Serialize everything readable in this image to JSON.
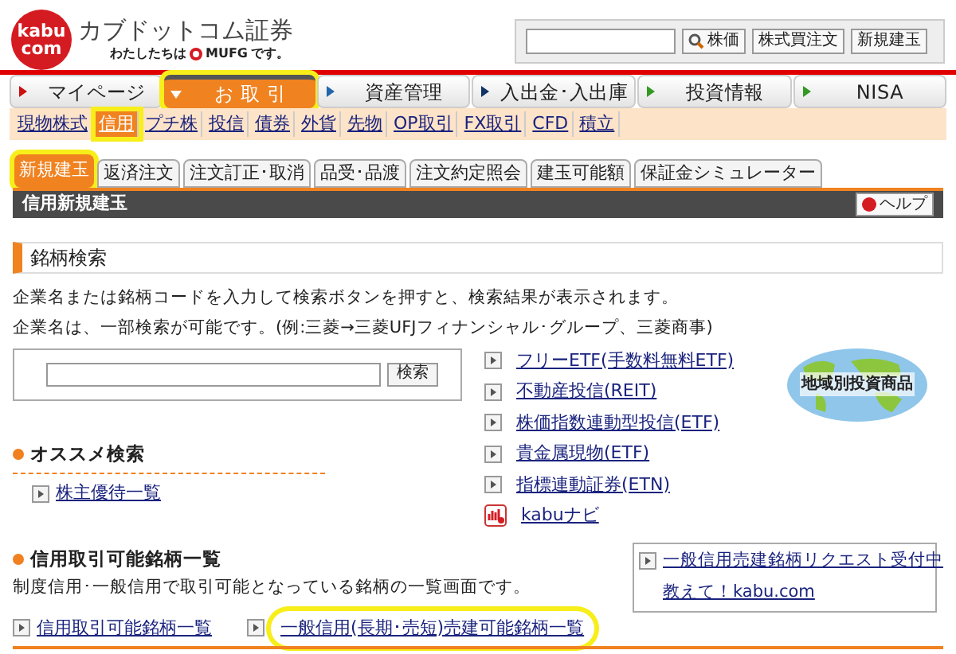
{
  "logo": {
    "mark_top": "kabu",
    "mark_bottom": "com",
    "name": "カブドットコム証券",
    "tagline_before": "わたしたちは",
    "tagline_brand": "MUFG",
    "tagline_after": "です。"
  },
  "quick_search": {
    "buttons": [
      "株価",
      "株式買注文",
      "新規建玉"
    ]
  },
  "main_nav": [
    {
      "label": "マイページ",
      "selected": false,
      "highlighted": false
    },
    {
      "label": "お 取 引",
      "selected": true,
      "highlighted": true
    },
    {
      "label": "資産管理",
      "selected": false,
      "highlighted": false
    },
    {
      "label": "入出金･入出庫",
      "selected": false,
      "highlighted": false
    },
    {
      "label": "投資情報",
      "selected": false,
      "highlighted": false
    },
    {
      "label": "NISA",
      "selected": false,
      "highlighted": false
    }
  ],
  "sub_nav": [
    {
      "label": "現物株式",
      "selected": false,
      "highlighted": false
    },
    {
      "label": "信用",
      "selected": true,
      "highlighted": true
    },
    {
      "label": "プチ株",
      "selected": false,
      "highlighted": false
    },
    {
      "label": "投信",
      "selected": false,
      "highlighted": false
    },
    {
      "label": "債券",
      "selected": false,
      "highlighted": false
    },
    {
      "label": "外貨",
      "selected": false,
      "highlighted": false
    },
    {
      "label": "先物",
      "selected": false,
      "highlighted": false
    },
    {
      "label": "OP取引",
      "selected": false,
      "highlighted": false
    },
    {
      "label": "FX取引",
      "selected": false,
      "highlighted": false
    },
    {
      "label": "CFD",
      "selected": false,
      "highlighted": false
    },
    {
      "label": "積立",
      "selected": false,
      "highlighted": false
    }
  ],
  "tabs": [
    {
      "label": "新規建玉",
      "selected": true,
      "highlighted": true
    },
    {
      "label": "返済注文",
      "selected": false,
      "highlighted": false
    },
    {
      "label": "注文訂正･取消",
      "selected": false,
      "highlighted": false
    },
    {
      "label": "品受･品渡",
      "selected": false,
      "highlighted": false
    },
    {
      "label": "注文約定照会",
      "selected": false,
      "highlighted": false
    },
    {
      "label": "建玉可能額",
      "selected": false,
      "highlighted": false
    },
    {
      "label": "保証金シミュレーター",
      "selected": false,
      "highlighted": false
    }
  ],
  "page_title": "信用新規建玉",
  "help_button": "ヘルプ",
  "section": {
    "title": "銘柄検索",
    "description": [
      "企業名または銘柄コードを入力して検索ボタンを押すと、検索結果が表示されます。",
      "企業名は、一部検索が可能です。(例:三菱→三菱UFJフィナンシャル･グループ、三菱商事)"
    ],
    "search_button": "検索"
  },
  "side_links": [
    {
      "label": "フリーETF(手数料無料ETF)",
      "kind": "arrow"
    },
    {
      "label": "不動産投信(REIT)",
      "kind": "arrow"
    },
    {
      "label": "株価指数連動型投信(ETF)",
      "kind": "arrow"
    },
    {
      "label": "貴金属現物(ETF)",
      "kind": "arrow"
    },
    {
      "label": "指標連動証券(ETN)",
      "kind": "arrow"
    },
    {
      "label": "kabuナビ",
      "kind": "app"
    }
  ],
  "region_badge": "地域別投資商品",
  "recommend": {
    "title": "オススメ検索",
    "links": [
      "株主優待一覧"
    ]
  },
  "margin_list": {
    "title": "信用取引可能銘柄一覧",
    "description": "制度信用･一般信用で取引可能となっている銘柄の一覧画面です。",
    "links": [
      {
        "label": "信用取引可能銘柄一覧",
        "highlighted": false
      },
      {
        "label": "一般信用(長期･売短)売建可能銘柄一覧",
        "highlighted": true
      }
    ],
    "request_box": [
      "一般信用売建銘柄リクエスト受付中",
      "教えて！kabu.com"
    ]
  }
}
